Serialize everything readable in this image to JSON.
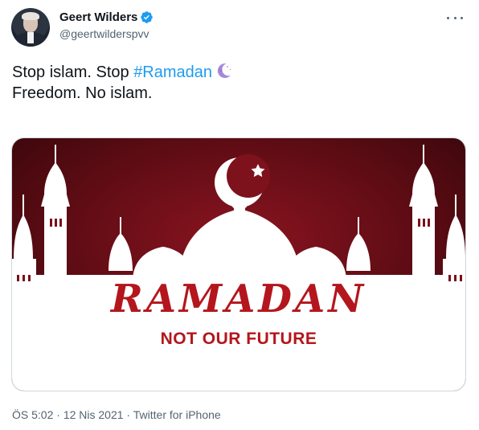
{
  "author": {
    "display_name": "Geert Wilders",
    "handle": "@geertwilderspvv",
    "verified": true
  },
  "tweet": {
    "line1_text": "Stop islam. Stop ",
    "hashtag": "#Ramadan",
    "line2_text": "Freedom. No islam."
  },
  "media": {
    "title": "RAMADAN",
    "subtitle": "NOT OUR FUTURE"
  },
  "meta": {
    "time": "ÖS 5:02",
    "separator": " · ",
    "date": "12 Nis 2021",
    "source": "Twitter for iPhone"
  },
  "icons": {
    "verified": "verified-badge-icon",
    "more": "more-options-icon",
    "emoji": "crescent-moon-emoji"
  },
  "colors": {
    "accent": "#1d9bf0",
    "text": "#0f1419",
    "muted": "#536471",
    "media_red": "#b3161c"
  }
}
